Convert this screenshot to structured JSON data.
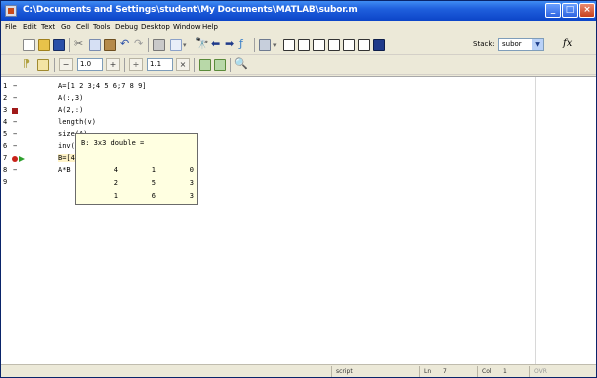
{
  "window": {
    "title": "C:\\Documents and Settings\\student\\My Documents\\MATLAB\\subor.m"
  },
  "menu": [
    "File",
    "Edit",
    "Text",
    "Go",
    "Cell",
    "Tools",
    "Debug",
    "Desktop",
    "Window",
    "Help"
  ],
  "toolbar": {
    "stack_label": "Stack:",
    "stack_value": "subor",
    "fx_label": "fx"
  },
  "cellbar": {
    "minus_label": "−",
    "value1": "1.0",
    "plus_label": "+",
    "divide_label": "÷",
    "value2": "1.1",
    "times_label": "×"
  },
  "editor": {
    "line_numbers": [
      "1",
      "2",
      "3",
      "4",
      "5",
      "6",
      "7",
      "8",
      "9"
    ],
    "lines": [
      "A=[1 2 3;4 5 6;7 8 9]",
      "A(:,3)",
      "A(2,:)",
      "length(v)",
      "size(A)",
      "inv(A)",
      "B=[4 1 0; 2 5 3;1 6 3]",
      "A*B",
      ""
    ]
  },
  "tooltip": {
    "header": "B: 3x3 double =",
    "rows": [
      [
        "4",
        "1",
        "0"
      ],
      [
        "2",
        "5",
        "3"
      ],
      [
        "1",
        "6",
        "3"
      ]
    ]
  },
  "status": {
    "mode": "script",
    "line_label": "Ln",
    "line_value": "7",
    "col_label": "Col",
    "col_value": "1",
    "ovr": "OVR"
  },
  "colors": {
    "title_bar": "#0c45c8",
    "breakpoint": "#c8231a",
    "exec_arrow": "#2ea02e",
    "tooltip_bg": "#ffffe1"
  }
}
